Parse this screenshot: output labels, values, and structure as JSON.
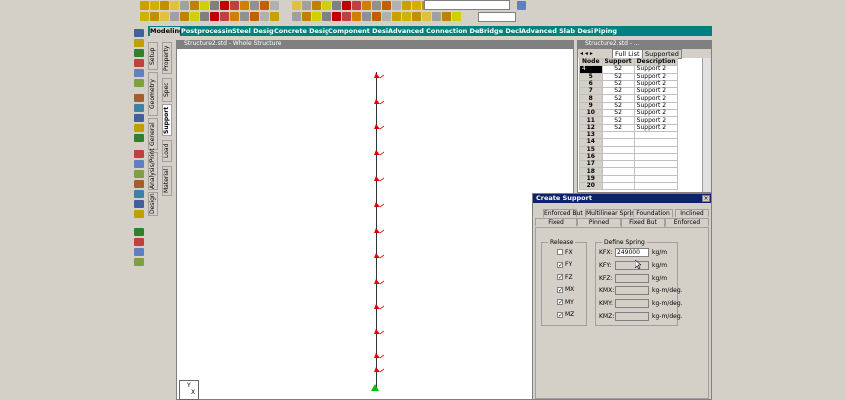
{
  "toolbar": {
    "combo1_value": "",
    "combo2_value": ""
  },
  "page_tabs": [
    "Modeling",
    "Postprocessing",
    "Steel Design",
    "Concrete Design",
    "Component Design",
    "Advanced Connection Design",
    "Bridge Deck",
    "Advanced Slab Design",
    "Piping"
  ],
  "vertical_tabs_left": [
    "Setup",
    "Geometry",
    "General",
    "Analysis/Print",
    "Design"
  ],
  "vertical_tabs_right": [
    "Property",
    "Spec",
    "Support",
    "Load",
    "Material"
  ],
  "view_window": {
    "title": "Structure2.std - Whole Structure"
  },
  "table_window": {
    "title": "Structure2.std - ...",
    "tabs": [
      "Full List",
      "Supported"
    ],
    "columns": [
      "Node",
      "Support",
      "Description"
    ],
    "rows": [
      [
        "4",
        "S2",
        "Support 2"
      ],
      [
        "5",
        "S2",
        "Support 2"
      ],
      [
        "6",
        "S2",
        "Support 2"
      ],
      [
        "7",
        "S2",
        "Support 2"
      ],
      [
        "8",
        "S2",
        "Support 2"
      ],
      [
        "9",
        "S2",
        "Support 2"
      ],
      [
        "10",
        "S2",
        "Support 2"
      ],
      [
        "11",
        "S2",
        "Support 2"
      ],
      [
        "12",
        "S2",
        "Support 2"
      ],
      [
        "13",
        "",
        ""
      ],
      [
        "14",
        "",
        ""
      ],
      [
        "15",
        "",
        ""
      ],
      [
        "16",
        "",
        ""
      ],
      [
        "17",
        "",
        ""
      ],
      [
        "18",
        "",
        ""
      ],
      [
        "19",
        "",
        ""
      ],
      [
        "20",
        "",
        ""
      ]
    ]
  },
  "dialog": {
    "title": "Create Support",
    "close": "×",
    "tabs_row1": [
      "Enforced But",
      "Multilinear Spring",
      "Foundation",
      "Inclined"
    ],
    "tabs_row2": [
      "Fixed",
      "Pinned",
      "Fixed But",
      "Enforced"
    ],
    "release": {
      "title": "Release",
      "items": [
        {
          "label": "FX",
          "checked": false
        },
        {
          "label": "FY",
          "checked": true
        },
        {
          "label": "FZ",
          "checked": true
        },
        {
          "label": "MX",
          "checked": true
        },
        {
          "label": "MY",
          "checked": true
        },
        {
          "label": "MZ",
          "checked": true
        }
      ]
    },
    "spring": {
      "title": "Define Spring",
      "items": [
        {
          "label": "KFX:",
          "value": "249000",
          "unit": "kg/m"
        },
        {
          "label": "KFY:",
          "value": "",
          "unit": "kg/m"
        },
        {
          "label": "KFZ:",
          "value": "",
          "unit": "kg/m"
        },
        {
          "label": "KMX:",
          "value": "",
          "unit": "kg-m/deg."
        },
        {
          "label": "KMY:",
          "value": "",
          "unit": "kg-m/deg."
        },
        {
          "label": "KMZ:",
          "value": "",
          "unit": "kg-m/deg."
        }
      ]
    }
  },
  "axis_labels": {
    "y": "Y",
    "x": "X"
  }
}
